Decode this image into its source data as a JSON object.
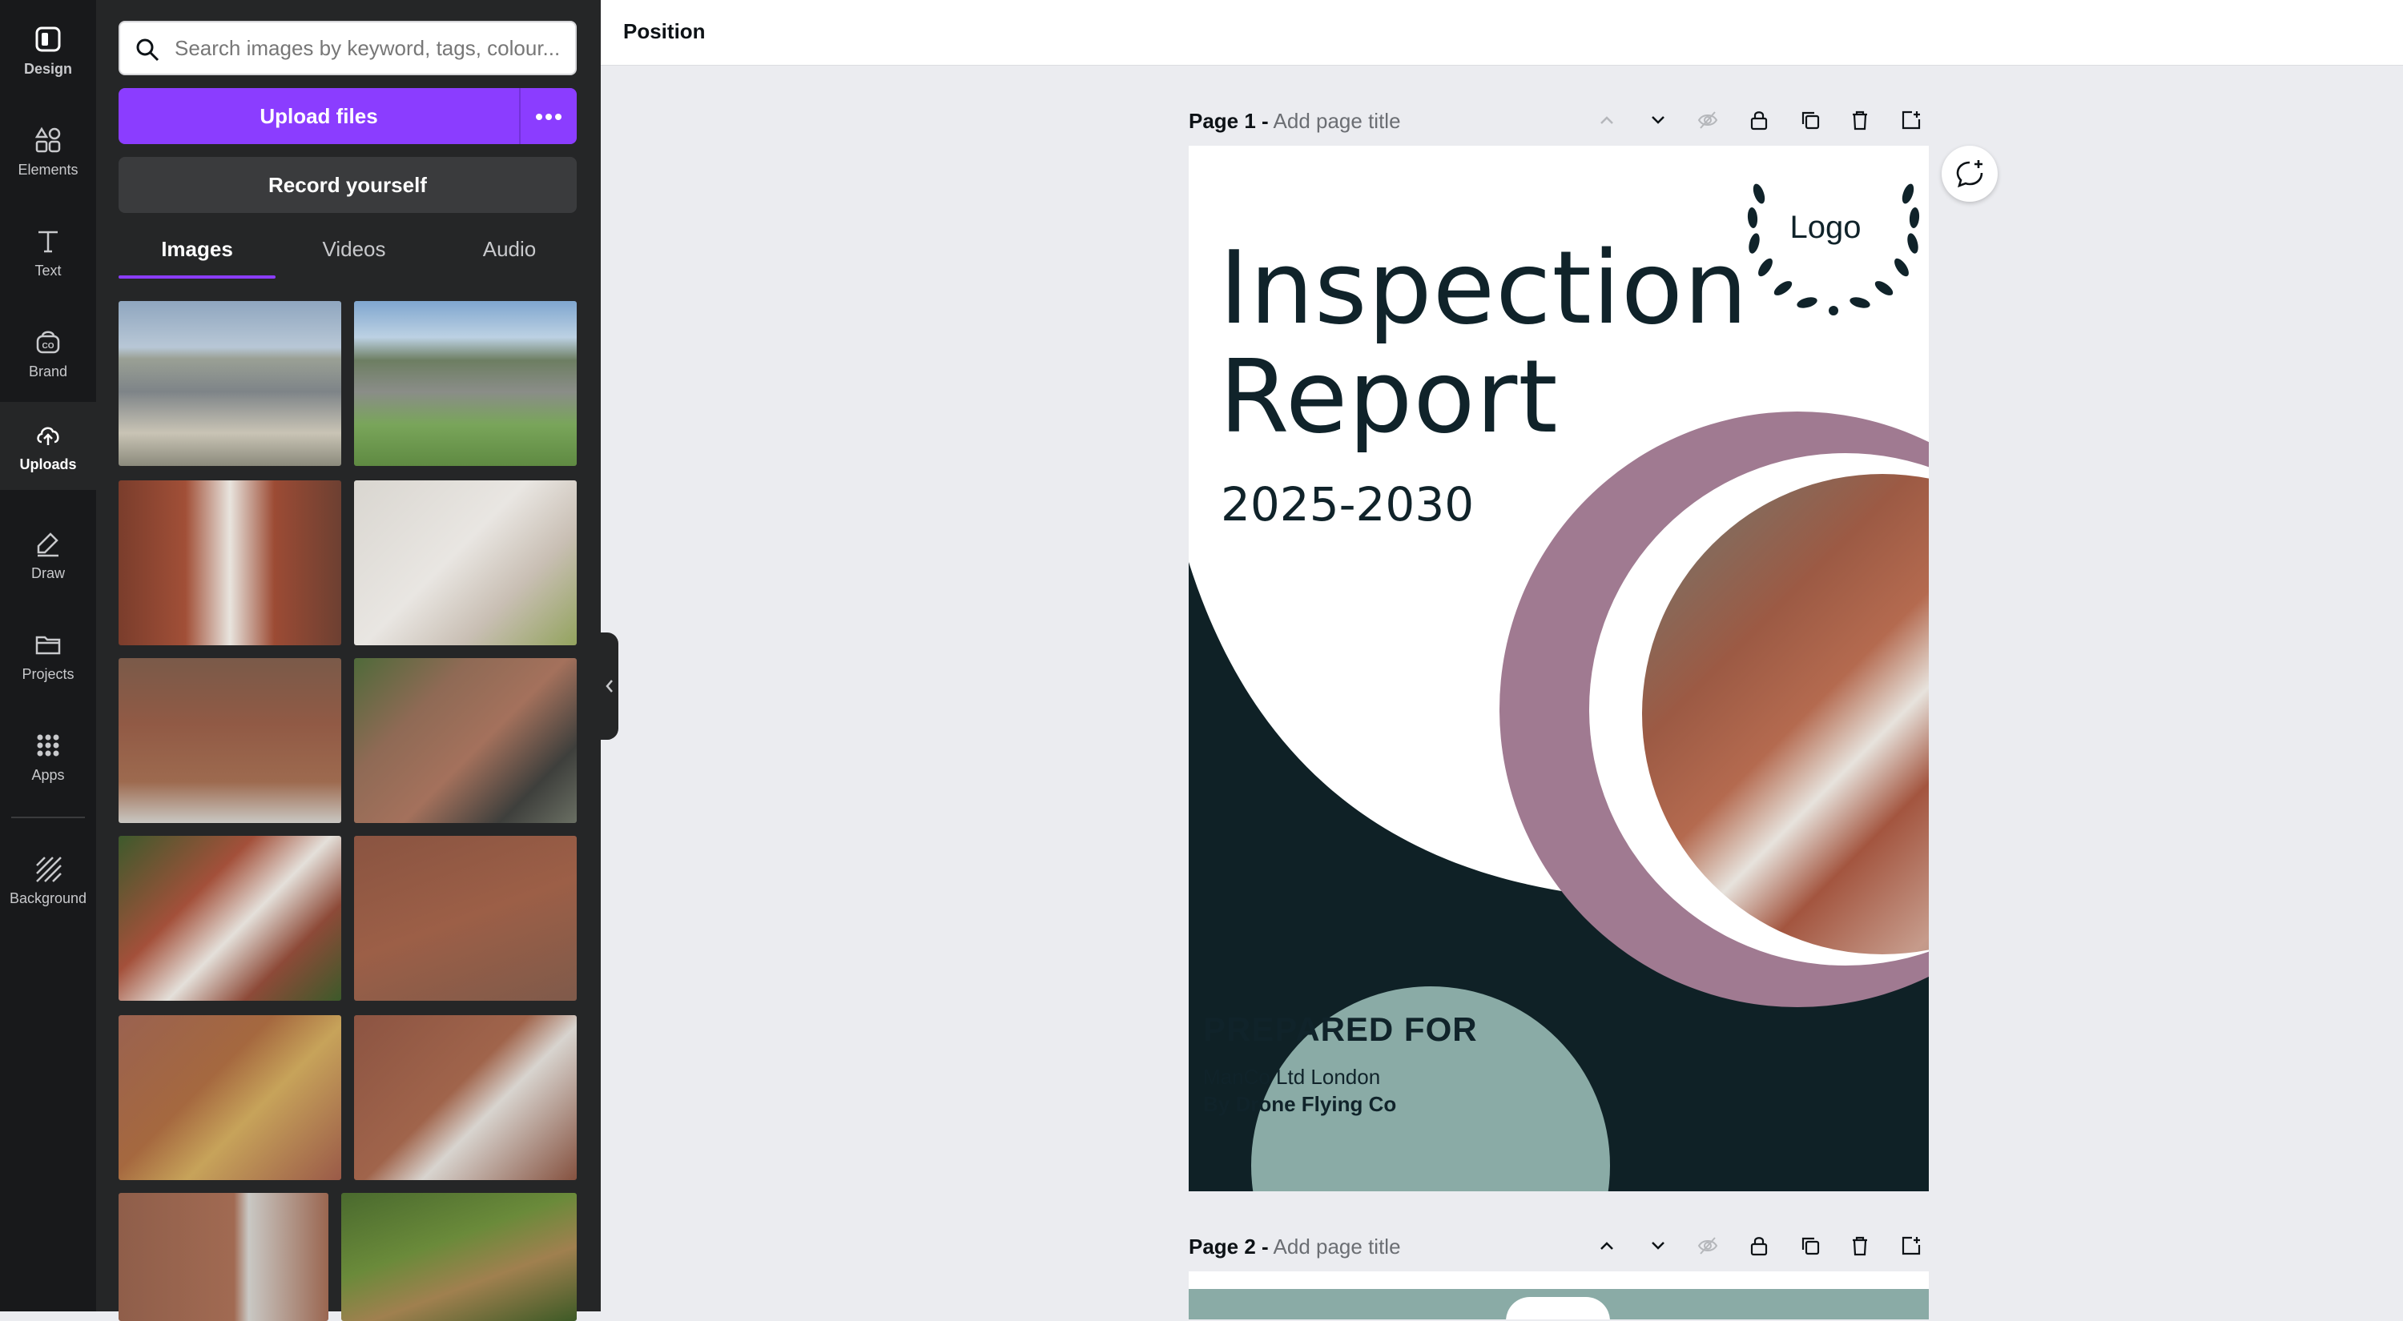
{
  "rail": {
    "items": [
      {
        "label": "Design",
        "icon": "design-icon"
      },
      {
        "label": "Elements",
        "icon": "elements-icon"
      },
      {
        "label": "Text",
        "icon": "text-icon"
      },
      {
        "label": "Brand",
        "icon": "brand-icon"
      },
      {
        "label": "Uploads",
        "icon": "uploads-cloud-icon"
      },
      {
        "label": "Draw",
        "icon": "draw-icon"
      },
      {
        "label": "Projects",
        "icon": "folder-icon"
      },
      {
        "label": "Apps",
        "icon": "apps-grid-icon"
      },
      {
        "label": "Background",
        "icon": "background-hatch-icon"
      }
    ],
    "active": "Uploads"
  },
  "panel": {
    "search_placeholder": "Search images by keyword, tags, colour...",
    "upload_label": "Upload files",
    "record_label": "Record yourself",
    "tabs": [
      "Images",
      "Videos",
      "Audio"
    ],
    "active_tab": "Images"
  },
  "topbar": {
    "title": "Position"
  },
  "pages": [
    {
      "label": "Page 1 -",
      "title_placeholder": "Add page title"
    },
    {
      "label": "Page 2 -",
      "title_placeholder": "Add page title"
    }
  ],
  "cover": {
    "title_line1": "Inspection",
    "title_line2": "Report",
    "years": "2025-2030",
    "logo": "Logo",
    "prepared_heading": "PREPARED FOR",
    "client": "ManCo Ltd London",
    "by": "By Drone Flying Co"
  },
  "colors": {
    "accent": "#8b3dff",
    "dark_teal": "#0f2126",
    "mauve": "#a07a91",
    "sage": "#8aaba6"
  }
}
